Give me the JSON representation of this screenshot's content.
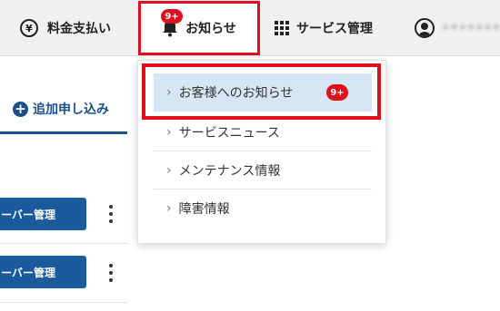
{
  "topnav": {
    "billing_label": "料金支払い",
    "billing_icon": "yen-icon",
    "billing_icon_glyph": "¥",
    "news_label": "お知らせ",
    "news_icon": "bell-icon",
    "news_badge": "9+",
    "service_label": "サービス管理",
    "service_icon": "grid-icon",
    "account_icon": "user-icon",
    "account_name": "••••••••"
  },
  "left_panel": {
    "add_icon": "plus-icon",
    "add_icon_glyph": "+",
    "add_label": "追加申し込み",
    "rows": [
      {
        "button_label": "ーバー管理",
        "menu_icon": "kebab-icon"
      },
      {
        "button_label": "ーバー管理",
        "menu_icon": "kebab-icon"
      }
    ]
  },
  "dropdown": {
    "items": [
      {
        "label": "お客様へのお知らせ",
        "badge": "9+",
        "chevron": "›"
      },
      {
        "label": "サービスニュース",
        "chevron": "›"
      },
      {
        "label": "メンテナンス情報",
        "chevron": "›"
      },
      {
        "label": "障害情報",
        "chevron": "›"
      }
    ]
  },
  "colors": {
    "accent_red": "#e00f1e",
    "brand_blue": "#1a4f8b",
    "button_blue": "#1a5b9e",
    "highlight_bg": "#d6e6f5",
    "nav_bg": "#f0f0f0"
  }
}
